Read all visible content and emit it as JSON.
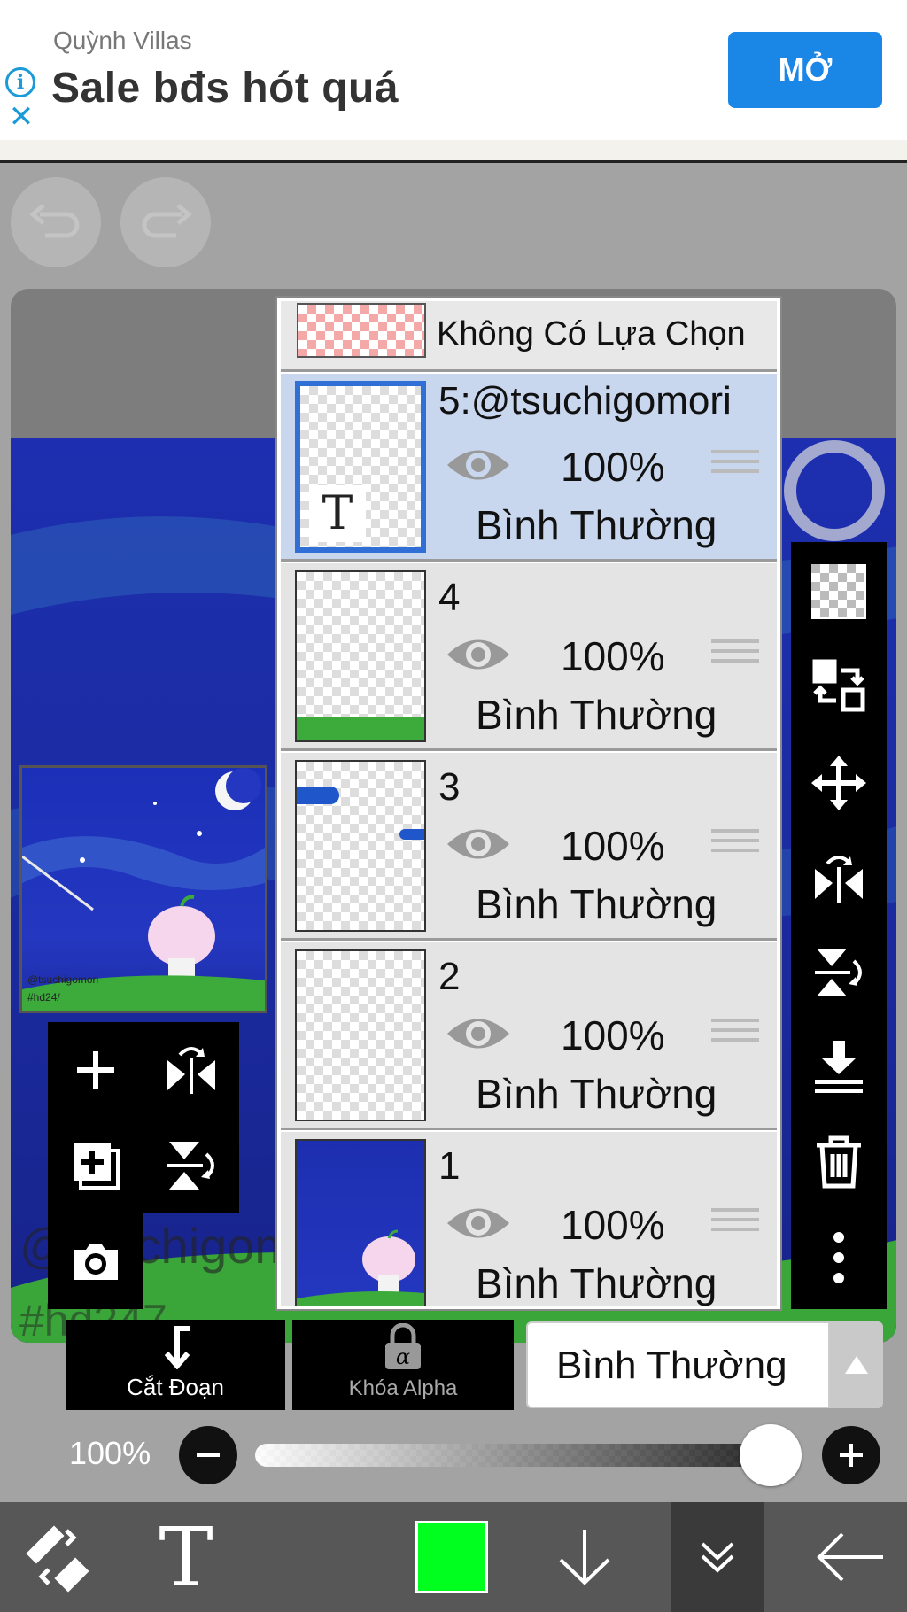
{
  "ad": {
    "sponsor": "Quỳnh Villas",
    "title": "Sale bđs hót quá",
    "button_label": "MỞ"
  },
  "layers": {
    "selection_row_label": "Không Có Lựa Chọn",
    "items": [
      {
        "name": "5:@tsuchigomori",
        "opacity": "100%",
        "blend": "Bình Thường",
        "selected": true
      },
      {
        "name": "4",
        "opacity": "100%",
        "blend": "Bình Thường",
        "selected": false
      },
      {
        "name": "3",
        "opacity": "100%",
        "blend": "Bình Thường",
        "selected": false
      },
      {
        "name": "2",
        "opacity": "100%",
        "blend": "Bình Thường",
        "selected": false
      },
      {
        "name": "1",
        "opacity": "100%",
        "blend": "Bình Thường",
        "selected": false
      }
    ]
  },
  "actions": {
    "clip_label": "Cắt Đoạn",
    "alpha_lock_label": "Khóa Alpha",
    "blend_mode_value": "Bình Thường"
  },
  "opacity": {
    "label": "100%",
    "value": 1.0
  },
  "preview": {
    "watermark_line1": "@tsuchigomori",
    "watermark_line2": "#hd24/"
  },
  "canvas_text": {
    "line1": "@tsuchigomo",
    "line2": "#hd247"
  },
  "colors": {
    "primary_color": "#00ff1e",
    "ad_button": "#1a86e6",
    "selected_layer": "#c8d6ee"
  }
}
